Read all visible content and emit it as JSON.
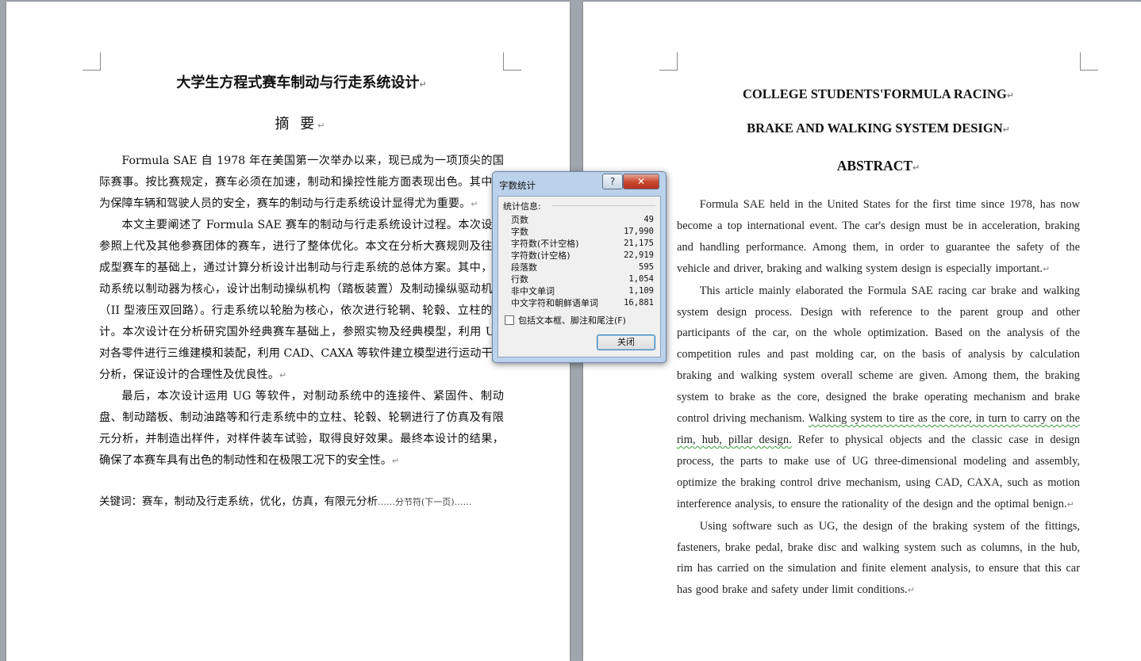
{
  "left_page": {
    "title": "大学生方程式赛车制动与行走系统设计",
    "subtitle": "摘  要",
    "paragraphs": [
      "Formula SAE 自 1978 年在美国第一次举办以来，现已成为一项顶尖的国际赛事。按比赛规定，赛车必须在加速，制动和操控性能方面表现出色。其中，为保障车辆和驾驶人员的安全，赛车的制动与行走系统设计显得尤为重要。",
      "本文主要阐述了 Formula SAE 赛车的制动与行走系统设计过程。本次设计参照上代及其他参赛团体的赛车，进行了整体优化。本文在分析大赛规则及往届成型赛车的基础上，通过计算分析设计出制动与行走系统的总体方案。其中，制动系统以制动器为核心，设计出制动操纵机构（踏板装置）及制动操纵驱动机构（II 型液压双回路）。行走系统以轮胎为核心，依次进行轮辋、轮毂、立柱的设计。本次设计在分析研究国外经典赛车基础上，参照实物及经典模型，利用 UG 对各零件进行三维建模和装配，利用 CAD、CAXA 等软件建立模型进行运动干涉分析，保证设计的合理性及优良性。",
      "最后，本次设计运用 UG 等软件，对制动系统中的连接件、紧固件、制动盘、制动踏板、制动油路等和行走系统中的立柱、轮毂、轮辋进行了仿真及有限元分析，并制造出样件，对样件装车试验，取得良好效果。最终本设计的结果，确保了本赛车具有出色的制动性和在极限工况下的安全性。"
    ],
    "keywords": "关键词：赛车，制动及行走系统，优化，仿真，有限元分析",
    "section_break": "分节符(下一页)"
  },
  "right_page": {
    "title_line1": "COLLEGE STUDENTS'FORMULA RACING",
    "title_line2": "BRAKE AND WALKING SYSTEM DESIGN",
    "abstract_heading": "ABSTRACT",
    "para1": "Formula SAE held in the United States for the first time since 1978, has now become a top international event. The car's design must be in acceleration, braking and handling performance. Among them, in order to guarantee the safety of the vehicle and driver, braking and walking system design is especially important.",
    "para2_before": "This article mainly elaborated the Formula SAE racing car brake and walking system design process. Design with reference to the parent group and other participants of the car, on the whole optimization. Based on the analysis of the competition rules and past molding car, on the basis of analysis by calculation braking and walking system overall scheme are given. Among them, the braking system to brake as the core, designed the brake operating mechanism and brake control driving mechanism. ",
    "para2_underlined": "Walking system to tire as the core, in turn to carry on the rim, hub, pillar design.",
    "para2_after": " Refer to physical objects and the classic case in design process, the parts to make use of UG three-dimensional modeling and assembly, optimize the braking control drive mechanism, using CAD, CAXA, such as motion interference analysis, to ensure the rationality of the design and the optimal  benign.",
    "para3": "Using software such as UG, the design of the braking system of the fittings, fasteners, brake pedal, brake disc and walking system such as columns, in the hub, rim has carried on the simulation and finite element analysis, to ensure that this car has good brake and safety under limit conditions."
  },
  "dialog": {
    "title": "字数统计",
    "help_label": "?",
    "close_x": "✕",
    "group_label": "统计信息:",
    "stats": [
      {
        "label": "页数",
        "value": "49"
      },
      {
        "label": "字数",
        "value": "17,990"
      },
      {
        "label": "字符数(不计空格)",
        "value": "21,175"
      },
      {
        "label": "字符数(计空格)",
        "value": "22,919"
      },
      {
        "label": "段落数",
        "value": "595"
      },
      {
        "label": "行数",
        "value": "1,054"
      },
      {
        "label": "非中文单词",
        "value": "1,109"
      },
      {
        "label": "中文字符和朝鲜语单词",
        "value": "16,881"
      }
    ],
    "include_label": "包括文本框、脚注和尾注(F)",
    "close_button": "关闭"
  },
  "marks": {
    "paragraph": "↵"
  }
}
